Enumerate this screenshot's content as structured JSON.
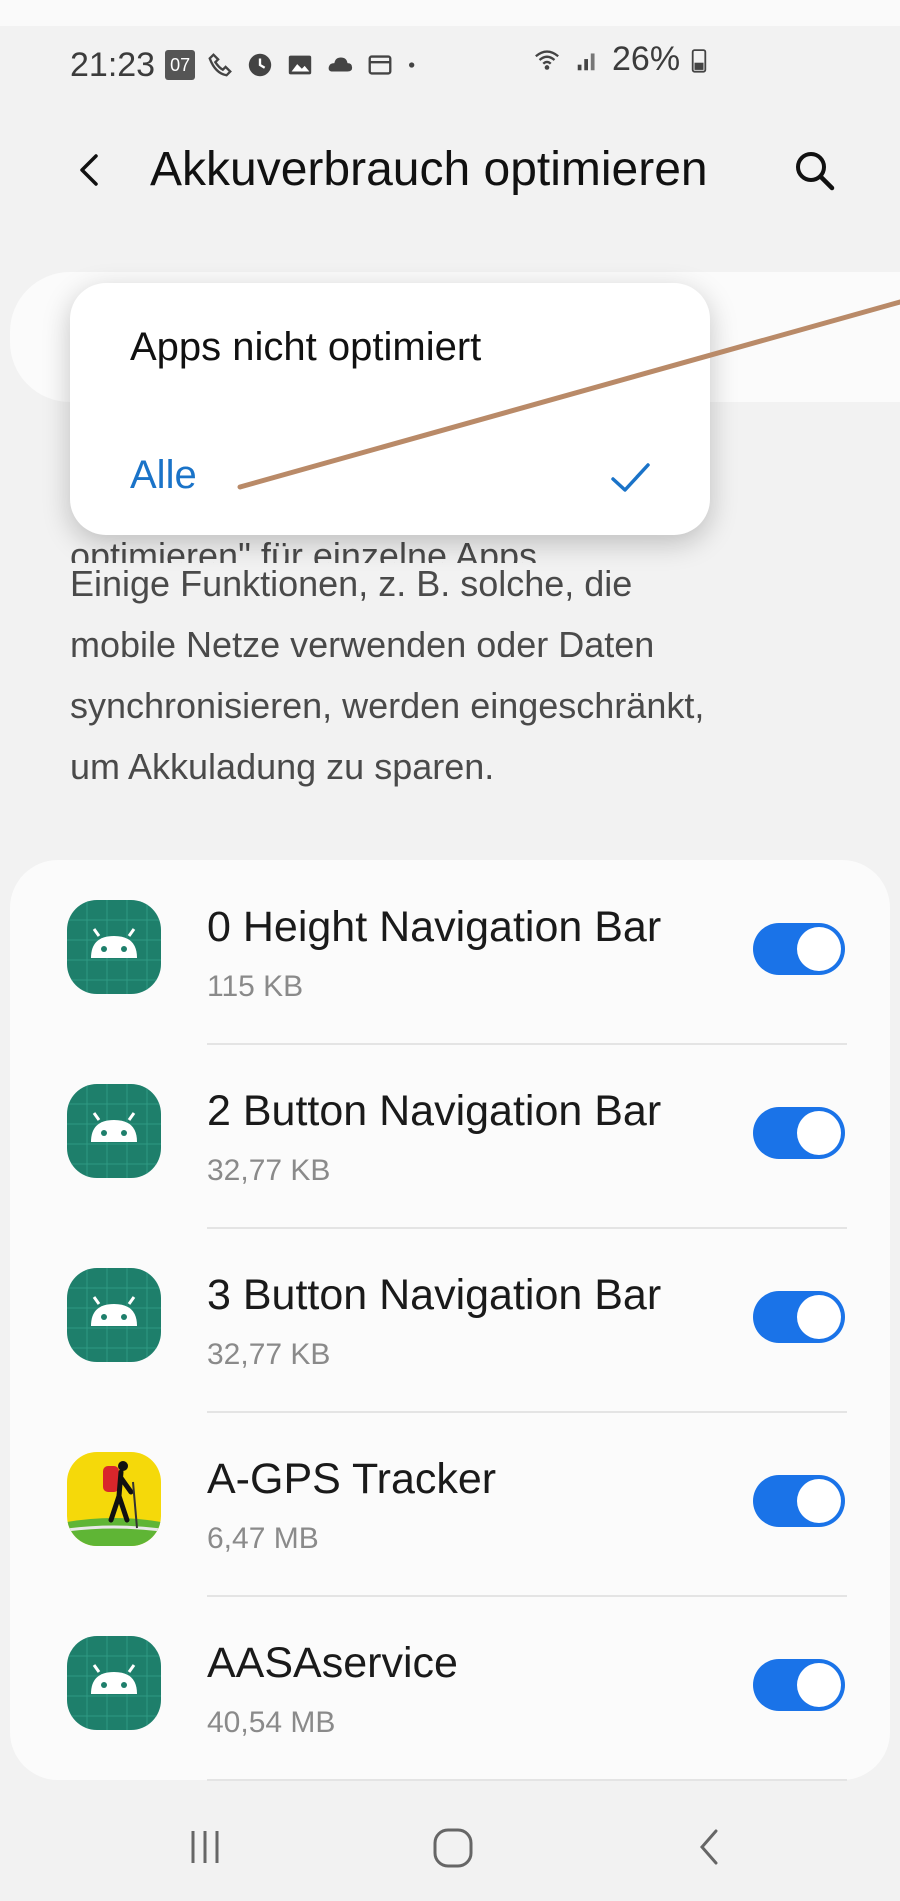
{
  "status_bar": {
    "time": "21:23",
    "badge": "07",
    "battery": "26%",
    "icons": [
      "calendar-icon",
      "call-icon",
      "alarm-icon",
      "gallery-icon",
      "cloud-icon",
      "message-icon",
      "dot-icon",
      "wifi-icon",
      "signal-icon",
      "battery-icon"
    ]
  },
  "app_bar": {
    "title": "Akkuverbrauch optimieren",
    "back_icon": "back-chevron-icon",
    "search_icon": "search-icon"
  },
  "filter_dropdown": {
    "options": [
      {
        "label": "Apps nicht optimiert",
        "selected": false
      },
      {
        "label": "Alle",
        "selected": true
      }
    ],
    "selected_color": "#1a73c8"
  },
  "description": {
    "partial_line": "optimieren\" für einzelne Apps.",
    "lines": [
      "Einige Funktionen, z. B. solche, die",
      "mobile Netze verwenden oder Daten",
      "synchronisieren, werden eingeschränkt,",
      "um Akkuladung zu sparen."
    ]
  },
  "apps": [
    {
      "name": "0 Height Navigation Bar",
      "size": "115 KB",
      "icon": "android-icon",
      "optimized": true
    },
    {
      "name": "2 Button Navigation Bar",
      "size": "32,77 KB",
      "icon": "android-icon",
      "optimized": true
    },
    {
      "name": "3 Button Navigation Bar",
      "size": "32,77 KB",
      "icon": "android-icon",
      "optimized": true
    },
    {
      "name": "A-GPS Tracker",
      "size": "6,47 MB",
      "icon": "hiker-icon",
      "optimized": true
    },
    {
      "name": "AASAservice",
      "size": "40,54 MB",
      "icon": "android-icon",
      "optimized": true
    }
  ],
  "nav_bar": {
    "icons": [
      "recent-apps-icon",
      "home-icon",
      "back-icon"
    ]
  },
  "colors": {
    "accent": "#1a73e8",
    "android_icon_bg": "#1e7f6b",
    "annotation_line": "#b98a68"
  }
}
